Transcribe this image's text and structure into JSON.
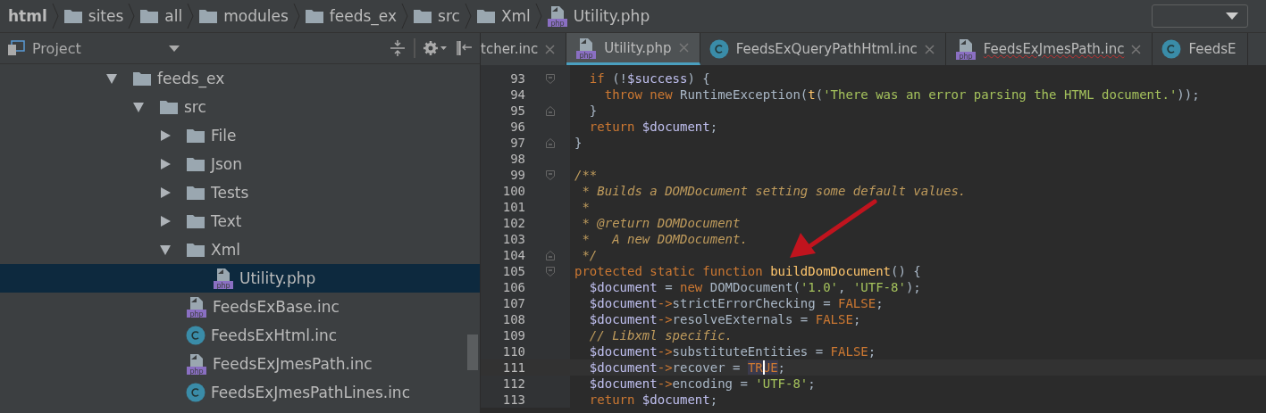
{
  "breadcrumb": [
    {
      "label": "html",
      "kind": "root"
    },
    {
      "label": "sites",
      "kind": "folder"
    },
    {
      "label": "all",
      "kind": "folder"
    },
    {
      "label": "modules",
      "kind": "folder"
    },
    {
      "label": "feeds_ex",
      "kind": "folder"
    },
    {
      "label": "src",
      "kind": "folder"
    },
    {
      "label": "Xml",
      "kind": "folder"
    },
    {
      "label": "Utility.php",
      "kind": "php"
    }
  ],
  "project_panel": {
    "title": "Project",
    "tree": [
      {
        "label": "feeds_ex",
        "kind": "folder",
        "expanded": true,
        "selected": false,
        "children": [
          {
            "label": "src",
            "kind": "folder",
            "expanded": true,
            "selected": false,
            "children": [
              {
                "label": "File",
                "kind": "folder",
                "expanded": false,
                "selected": false
              },
              {
                "label": "Json",
                "kind": "folder",
                "expanded": false,
                "selected": false
              },
              {
                "label": "Tests",
                "kind": "folder",
                "expanded": false,
                "selected": false
              },
              {
                "label": "Text",
                "kind": "folder",
                "expanded": false,
                "selected": false
              },
              {
                "label": "Xml",
                "kind": "folder",
                "expanded": true,
                "selected": false,
                "children": [
                  {
                    "label": "Utility.php",
                    "kind": "php",
                    "selected": true
                  }
                ]
              },
              {
                "label": "FeedsExBase.inc",
                "kind": "php",
                "selected": false
              },
              {
                "label": "FeedsExHtml.inc",
                "kind": "class",
                "selected": false
              },
              {
                "label": "FeedsExJmesPath.inc",
                "kind": "php",
                "selected": false
              },
              {
                "label": "FeedsExJmesPathLines.inc",
                "kind": "class",
                "selected": false
              }
            ]
          }
        ]
      }
    ]
  },
  "tabs": [
    {
      "label": "tcher.inc",
      "kind": "none",
      "selected": false
    },
    {
      "label": "Utility.php",
      "kind": "php",
      "selected": true
    },
    {
      "label": "FeedsExQueryPathHtml.inc",
      "kind": "class",
      "selected": false
    },
    {
      "label": "FeedsExJmesPath.inc",
      "kind": "php",
      "selected": false
    },
    {
      "label": "FeedsE",
      "kind": "class",
      "selected": false
    }
  ],
  "code": [
    {
      "number": "93",
      "fold_open": true,
      "fold_close": false,
      "current": false,
      "tokens": [
        {
          "text": "  if",
          "kind": "keyword"
        },
        {
          "text": " (!",
          "kind": "plain"
        },
        {
          "text": "$success",
          "kind": "var"
        },
        {
          "text": ") {",
          "kind": "plain"
        }
      ]
    },
    {
      "number": "94",
      "fold_open": false,
      "fold_close": false,
      "current": false,
      "tokens": [
        {
          "text": "    throw new",
          "kind": "keyword"
        },
        {
          "text": " RuntimeException(",
          "kind": "plain"
        },
        {
          "text": "t",
          "kind": "func"
        },
        {
          "text": "(",
          "kind": "plain"
        },
        {
          "text": "'There was an error parsing the HTML document.'",
          "kind": "string"
        },
        {
          "text": "));",
          "kind": "plain"
        }
      ]
    },
    {
      "number": "95",
      "fold_open": false,
      "fold_close": true,
      "current": false,
      "tokens": [
        {
          "text": "  }",
          "kind": "plain"
        }
      ]
    },
    {
      "number": "96",
      "fold_open": false,
      "fold_close": false,
      "current": false,
      "tokens": [
        {
          "text": "  return ",
          "kind": "keyword"
        },
        {
          "text": "$document",
          "kind": "var"
        },
        {
          "text": ";",
          "kind": "plain"
        }
      ]
    },
    {
      "number": "97",
      "fold_open": false,
      "fold_close": true,
      "current": false,
      "tokens": [
        {
          "text": "}",
          "kind": "plain"
        }
      ]
    },
    {
      "number": "98",
      "fold_open": false,
      "fold_close": false,
      "current": false
    },
    {
      "number": "99",
      "fold_open": true,
      "fold_close": false,
      "current": false,
      "tokens": [
        {
          "text": "/**",
          "kind": "doc"
        }
      ]
    },
    {
      "number": "100",
      "fold_open": false,
      "fold_close": false,
      "current": false,
      "tokens": [
        {
          "text": " * Builds a DOMDocument setting some default values.",
          "kind": "doc"
        }
      ]
    },
    {
      "number": "101",
      "fold_open": false,
      "fold_close": false,
      "current": false,
      "tokens": [
        {
          "text": " *",
          "kind": "doc"
        }
      ]
    },
    {
      "number": "102",
      "fold_open": false,
      "fold_close": false,
      "current": false,
      "tokens": [
        {
          "text": " * @return DOMDocument",
          "kind": "doc"
        }
      ]
    },
    {
      "number": "103",
      "fold_open": false,
      "fold_close": false,
      "current": false,
      "tokens": [
        {
          "text": " *   A new DOMDocument.",
          "kind": "doc"
        }
      ]
    },
    {
      "number": "104",
      "fold_open": false,
      "fold_close": true,
      "current": false,
      "tokens": [
        {
          "text": " */",
          "kind": "doc"
        }
      ]
    },
    {
      "number": "105",
      "fold_open": true,
      "fold_close": false,
      "current": false,
      "tokens": [
        {
          "text": "protected static function ",
          "kind": "keyword"
        },
        {
          "text": "buildDomDocument",
          "kind": "func"
        },
        {
          "text": "() {",
          "kind": "plain"
        }
      ]
    },
    {
      "number": "106",
      "fold_open": false,
      "fold_close": false,
      "current": false,
      "tokens": [
        {
          "text": "  $document",
          "kind": "var"
        },
        {
          "text": " = ",
          "kind": "plain"
        },
        {
          "text": "new",
          "kind": "keyword"
        },
        {
          "text": " DOMDocument(",
          "kind": "plain"
        },
        {
          "text": "'1.0'",
          "kind": "string"
        },
        {
          "text": ", ",
          "kind": "plain"
        },
        {
          "text": "'UTF-8'",
          "kind": "string"
        },
        {
          "text": ");",
          "kind": "plain"
        }
      ]
    },
    {
      "number": "107",
      "fold_open": false,
      "fold_close": false,
      "current": false,
      "tokens": [
        {
          "text": "  $document",
          "kind": "var"
        },
        {
          "text": "->",
          "kind": "keyword"
        },
        {
          "text": "strictErrorChecking = ",
          "kind": "plain"
        },
        {
          "text": "FALSE",
          "kind": "keyword"
        },
        {
          "text": ";",
          "kind": "plain"
        }
      ]
    },
    {
      "number": "108",
      "fold_open": false,
      "fold_close": false,
      "current": false,
      "tokens": [
        {
          "text": "  $document",
          "kind": "var"
        },
        {
          "text": "->",
          "kind": "keyword"
        },
        {
          "text": "resolveExternals = ",
          "kind": "plain"
        },
        {
          "text": "FALSE",
          "kind": "keyword"
        },
        {
          "text": ";",
          "kind": "plain"
        }
      ]
    },
    {
      "number": "109",
      "fold_open": false,
      "fold_close": false,
      "current": false,
      "tokens": [
        {
          "text": "  // Libxml specific.",
          "kind": "comment"
        }
      ]
    },
    {
      "number": "110",
      "fold_open": false,
      "fold_close": false,
      "current": false,
      "tokens": [
        {
          "text": "  $document",
          "kind": "var"
        },
        {
          "text": "->",
          "kind": "keyword"
        },
        {
          "text": "substituteEntities = ",
          "kind": "plain"
        },
        {
          "text": "FALSE",
          "kind": "keyword"
        },
        {
          "text": ";",
          "kind": "plain"
        }
      ]
    },
    {
      "number": "111",
      "fold_open": false,
      "fold_close": false,
      "current": true,
      "tokens": [
        {
          "text": "  $document",
          "kind": "var"
        },
        {
          "text": "->",
          "kind": "keyword"
        },
        {
          "text": "recover = ",
          "kind": "plain"
        },
        {
          "text": "TRUE",
          "kind": "match"
        },
        {
          "text": ";",
          "kind": "plain"
        }
      ]
    },
    {
      "number": "112",
      "fold_open": false,
      "fold_close": false,
      "current": false,
      "tokens": [
        {
          "text": "  $document",
          "kind": "var"
        },
        {
          "text": "->",
          "kind": "keyword"
        },
        {
          "text": "encoding = ",
          "kind": "plain"
        },
        {
          "text": "'UTF-8'",
          "kind": "string"
        },
        {
          "text": ";",
          "kind": "plain"
        }
      ]
    },
    {
      "number": "113",
      "fold_open": false,
      "fold_close": false,
      "current": false,
      "tokens": [
        {
          "text": "  return ",
          "kind": "keyword"
        },
        {
          "text": "$document",
          "kind": "var"
        },
        {
          "text": ";",
          "kind": "plain"
        }
      ]
    }
  ]
}
